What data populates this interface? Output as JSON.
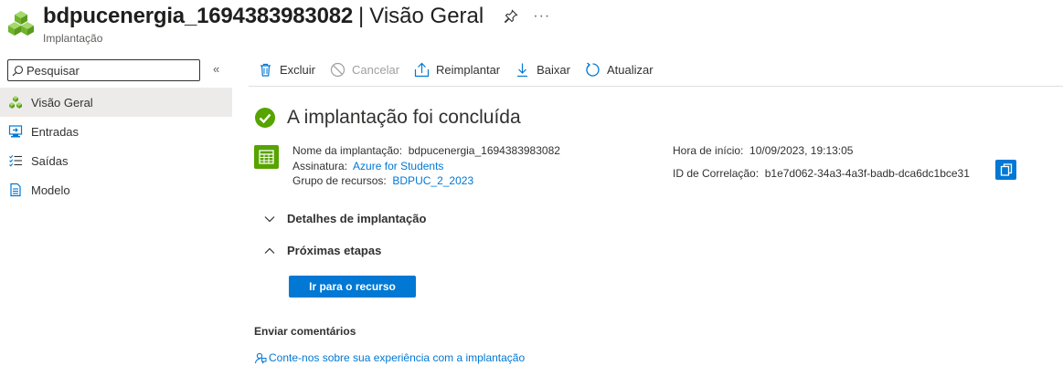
{
  "header": {
    "resource_name": "bdpucenergia_1694383983082",
    "separator": "|",
    "blade_title": "Visão Geral",
    "resource_type": "Implantação",
    "more_label": "···"
  },
  "sidebar": {
    "search_placeholder": "Pesquisar",
    "collapse_label": "«",
    "items": [
      {
        "label": "Visão Geral",
        "icon": "cubes-icon",
        "active": true
      },
      {
        "label": "Entradas",
        "icon": "inputs-icon"
      },
      {
        "label": "Saídas",
        "icon": "outputs-icon"
      },
      {
        "label": "Modelo",
        "icon": "template-icon"
      }
    ]
  },
  "toolbar": {
    "delete_label": "Excluir",
    "cancel_label": "Cancelar",
    "redeploy_label": "Reimplantar",
    "download_label": "Baixar",
    "refresh_label": "Atualizar"
  },
  "status": {
    "message": "A implantação foi concluída"
  },
  "details": {
    "deployment_name_key": "Nome da implantação:",
    "deployment_name_value": "bdpucenergia_1694383983082",
    "subscription_key": "Assinatura:",
    "subscription_value": "Azure for Students",
    "resource_group_key": "Grupo de recursos:",
    "resource_group_value": "BDPUC_2_2023",
    "start_time_key": "Hora de início:",
    "start_time_value": "10/09/2023, 19:13:05",
    "correlation_key": "ID de Correlação:",
    "correlation_value": "b1e7d062-34a3-4a3f-badb-dca6dc1bce31"
  },
  "sections": {
    "deployment_details": "Detalhes de implantação",
    "next_steps": "Próximas etapas"
  },
  "actions": {
    "go_to_resource": "Ir para o recurso"
  },
  "feedback": {
    "title": "Enviar comentários",
    "link": "Conte-nos sobre sua experiência com a implantação"
  },
  "colors": {
    "accent": "#0078d4",
    "success": "#57a300",
    "nav_active_bg": "#edebe9"
  }
}
